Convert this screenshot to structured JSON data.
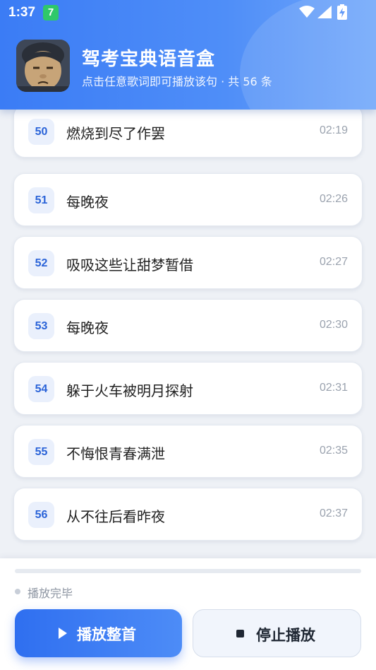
{
  "status_bar": {
    "time": "1:37",
    "notification_badge": "7"
  },
  "header": {
    "title": "驾考宝典语音盒",
    "subtitle": "点击任意歌词即可播放该句 · 共 56 条"
  },
  "lyrics": [
    {
      "index": "50",
      "text": "燃烧到尽了作罢",
      "time": "02:19"
    },
    {
      "index": "51",
      "text": "每晚夜",
      "time": "02:26"
    },
    {
      "index": "52",
      "text": "吸吸这些让甜梦暂借",
      "time": "02:27"
    },
    {
      "index": "53",
      "text": "每晚夜",
      "time": "02:30"
    },
    {
      "index": "54",
      "text": "躲于火车被明月探射",
      "time": "02:31"
    },
    {
      "index": "55",
      "text": "不悔恨青春满泄",
      "time": "02:35"
    },
    {
      "index": "56",
      "text": "从不往后看昨夜",
      "time": "02:37"
    }
  ],
  "player": {
    "status": "播放完毕",
    "progress": 0,
    "play_label": "播放整首",
    "stop_label": "停止播放"
  },
  "colors": {
    "accent": "#3b7cf5",
    "accent_light": "#eaf0fc"
  }
}
